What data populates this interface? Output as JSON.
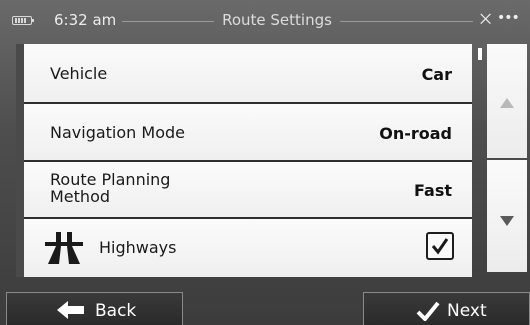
{
  "status_bar": {
    "time": "6:32 am",
    "title": "Route Settings",
    "battery_icon": "battery-icon",
    "gps_icon": "satellite-icon",
    "signal_icon": "signal-dots-icon"
  },
  "settings": {
    "vehicle": {
      "label": "Vehicle",
      "value": "Car"
    },
    "navigation_mode": {
      "label": "Navigation Mode",
      "value": "On-road"
    },
    "route_planning": {
      "label": "Route Planning Method",
      "value": "Fast"
    },
    "highways": {
      "label": "Highways",
      "checked": true,
      "icon": "highway-icon"
    }
  },
  "scroll": {
    "up_icon": "triangle-up-icon",
    "down_icon": "triangle-down-icon"
  },
  "bottom_bar": {
    "back_label": "Back",
    "next_label": "Next",
    "back_icon": "arrow-left-icon",
    "next_icon": "checkmark-icon"
  },
  "colors": {
    "background": "#4e4e4e",
    "row_background": "#f5f5f5",
    "button_background": "#2e2e2e",
    "text_light": "#ffffff",
    "text_dark": "#111111"
  }
}
